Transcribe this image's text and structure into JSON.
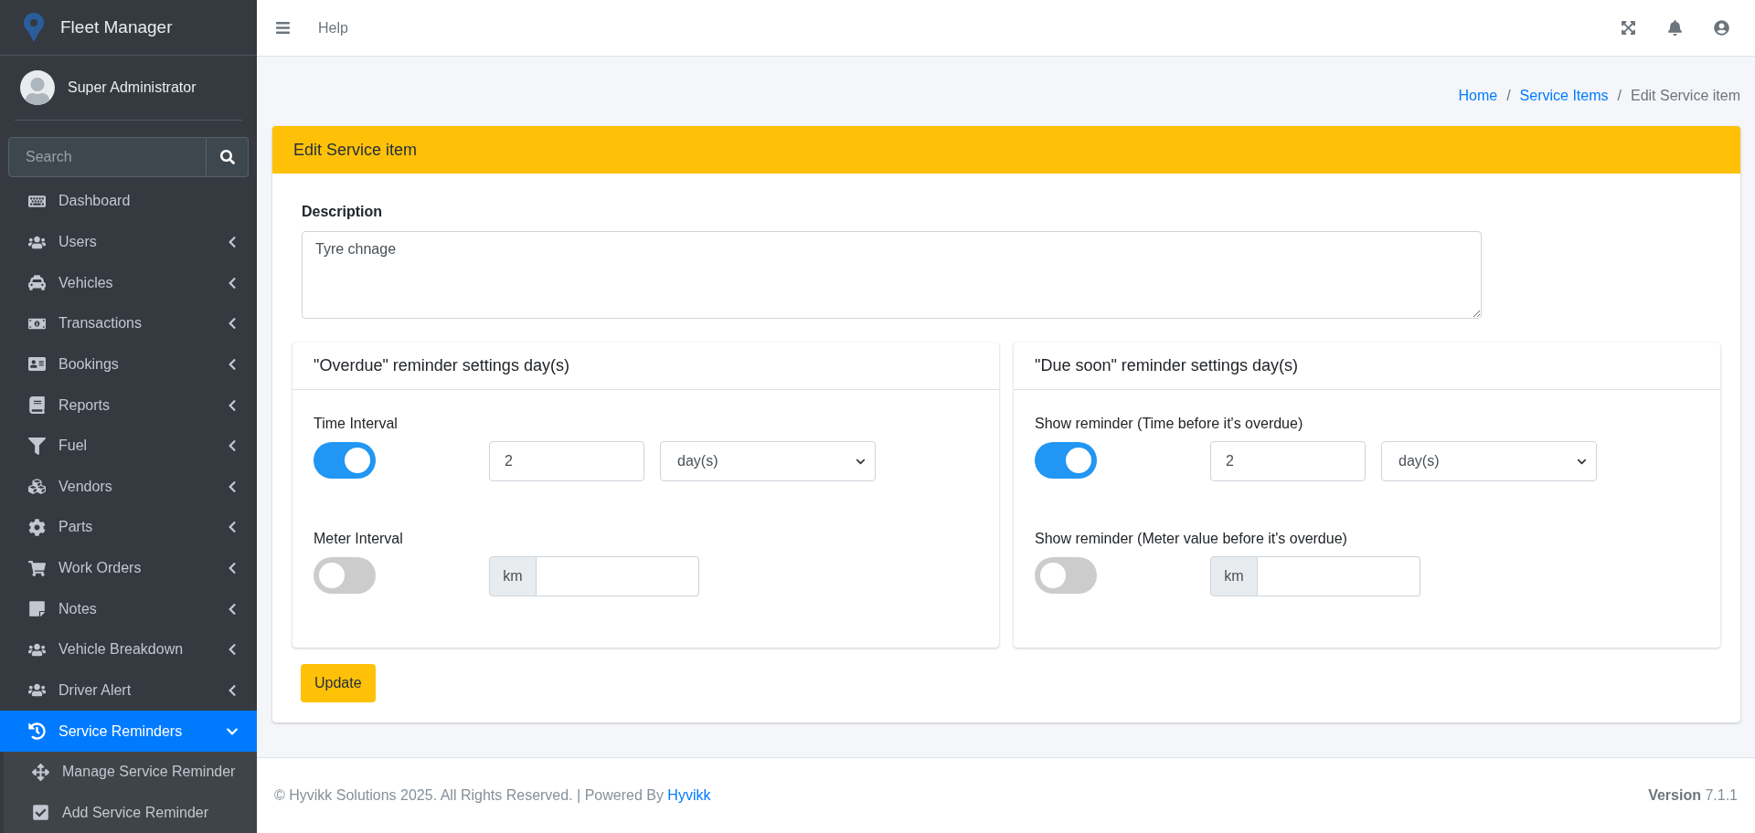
{
  "brand": {
    "title": "Fleet Manager"
  },
  "user": {
    "name": "Super Administrator"
  },
  "sidebar_search": {
    "placeholder": "Search"
  },
  "sidebar": {
    "items": [
      {
        "label": "Dashboard",
        "kind": "link",
        "selected": false
      },
      {
        "label": "Users",
        "kind": "group",
        "selected": false,
        "expanded": false
      },
      {
        "label": "Vehicles",
        "kind": "group",
        "selected": false,
        "expanded": false
      },
      {
        "label": "Transactions",
        "kind": "group",
        "selected": false,
        "expanded": false
      },
      {
        "label": "Bookings",
        "kind": "group",
        "selected": false,
        "expanded": false
      },
      {
        "label": "Reports",
        "kind": "group",
        "selected": false,
        "expanded": false
      },
      {
        "label": "Fuel",
        "kind": "group",
        "selected": false,
        "expanded": false
      },
      {
        "label": "Vendors",
        "kind": "group",
        "selected": false,
        "expanded": false
      },
      {
        "label": "Parts",
        "kind": "group",
        "selected": false,
        "expanded": false
      },
      {
        "label": "Work Orders",
        "kind": "group",
        "selected": false,
        "expanded": false
      },
      {
        "label": "Notes",
        "kind": "group",
        "selected": false,
        "expanded": false
      },
      {
        "label": "Vehicle Breakdown",
        "kind": "group",
        "selected": false,
        "expanded": false
      },
      {
        "label": "Driver Alert",
        "kind": "group",
        "selected": false,
        "expanded": false
      },
      {
        "label": "Service Reminders",
        "kind": "group",
        "selected": true,
        "expanded": true,
        "children": [
          {
            "label": "Manage Service Reminder",
            "selected": false
          },
          {
            "label": "Add Service Reminder",
            "selected": false
          }
        ]
      }
    ]
  },
  "topbar": {
    "links": [
      "Help"
    ]
  },
  "breadcrumb": [
    {
      "label": "Home",
      "link": true
    },
    {
      "separator": "/",
      "label": "Service Items",
      "link": true
    },
    {
      "separator": "/",
      "label": "Edit Service item",
      "link": false
    }
  ],
  "card": {
    "title": "Edit Service item",
    "description": {
      "label": "Description",
      "value": "Tyre chnage"
    },
    "panels": [
      {
        "title": "\"Overdue\" reminder settings day(s)",
        "rows": [
          {
            "kind": "time",
            "label": "Time Interval",
            "on": true,
            "value": "2",
            "unit": "day(s)"
          },
          {
            "kind": "meter",
            "label": "Meter Interval",
            "on": false,
            "addon": "km"
          }
        ]
      },
      {
        "title": "\"Due soon\" reminder settings day(s)",
        "rows": [
          {
            "kind": "time",
            "label": "Show reminder (Time before it's overdue)",
            "on": true,
            "value": "2",
            "unit": "day(s)"
          },
          {
            "kind": "meter",
            "label": "Show reminder (Meter value before it's overdue)",
            "on": false,
            "addon": "km"
          }
        ]
      }
    ],
    "button": "Update"
  },
  "footer": {
    "text": "© Hyvikk Solutions 2025. All Rights Reserved. | Powered By ",
    "link": "Hyvikk",
    "version": "**Version** 7.1.1"
  }
}
